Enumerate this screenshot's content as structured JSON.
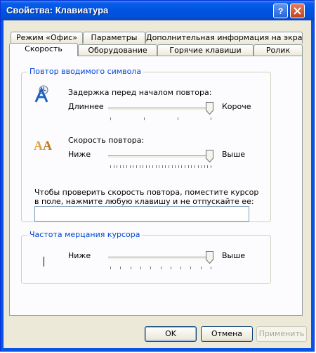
{
  "window": {
    "title": "Свойства: Клавиатура"
  },
  "tabs": {
    "row1": [
      "Режим «Офис»",
      "Параметры",
      "Дополнительная информация на экране"
    ],
    "row2": [
      "Скорость",
      "Оборудование",
      "Горячие клавиши",
      "Ролик"
    ],
    "active": "Скорость"
  },
  "repeat_group": {
    "title": "Повтор вводимого символа",
    "delay": {
      "label": "Задержка перед началом повтора:",
      "left": "Длиннее",
      "right": "Короче",
      "value_fraction": 1.0
    },
    "rate": {
      "label": "Скорость повтора:",
      "left": "Ниже",
      "right": "Выше",
      "value_fraction": 1.0
    },
    "test_hint": "Чтобы проверить скорость повтора, поместите курсор в поле, нажмите любую клавишу и не отпускайте ее:",
    "test_value": ""
  },
  "blink_group": {
    "title": "Частота мерцания курсора",
    "left": "Ниже",
    "right": "Выше",
    "value_fraction": 1.0
  },
  "buttons": {
    "ok": "OK",
    "cancel": "Отмена",
    "apply": "Применить"
  },
  "colors": {
    "titlebar": "#0054e3",
    "group_title": "#0046d5",
    "accent_icon": "#1f5fbf"
  }
}
